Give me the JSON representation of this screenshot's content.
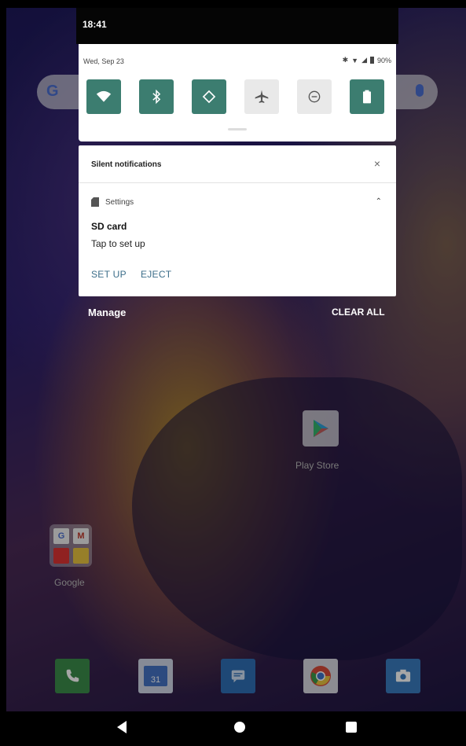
{
  "status_bar": {
    "time": "18:41"
  },
  "quick_settings": {
    "date": "Wed, Sep 23",
    "battery": "90%",
    "tiles": [
      {
        "name": "wifi",
        "icon": "wifi-icon",
        "state": "on"
      },
      {
        "name": "bluetooth",
        "icon": "bluetooth-icon",
        "state": "on"
      },
      {
        "name": "auto-rotate",
        "icon": "rotate-icon",
        "state": "on"
      },
      {
        "name": "airplane-mode",
        "icon": "airplane-icon",
        "state": "off"
      },
      {
        "name": "do-not-disturb",
        "icon": "dnd-icon",
        "state": "off"
      },
      {
        "name": "battery-saver",
        "icon": "battery-icon",
        "state": "on"
      }
    ],
    "accent": "#3c7d70"
  },
  "notification_group": {
    "title": "Silent notifications",
    "close_glyph": "×",
    "notification": {
      "app_name": "Settings",
      "expand_glyph": "⌃",
      "title": "SD card",
      "text": "Tap to set up",
      "actions": {
        "setup": "SET UP",
        "eject": "EJECT"
      }
    }
  },
  "shade_footer": {
    "manage": "Manage",
    "clear_all": "CLEAR ALL"
  },
  "home": {
    "search_logo": "G",
    "play_store_label": "Play Store",
    "folder_label": "Google",
    "folder_apps": [
      "G",
      "M",
      "YT",
      "D"
    ]
  },
  "dock": [
    "phone-icon",
    "calendar-icon",
    "messages-icon",
    "chrome-icon",
    "camera-icon"
  ],
  "calendar_day": "31"
}
